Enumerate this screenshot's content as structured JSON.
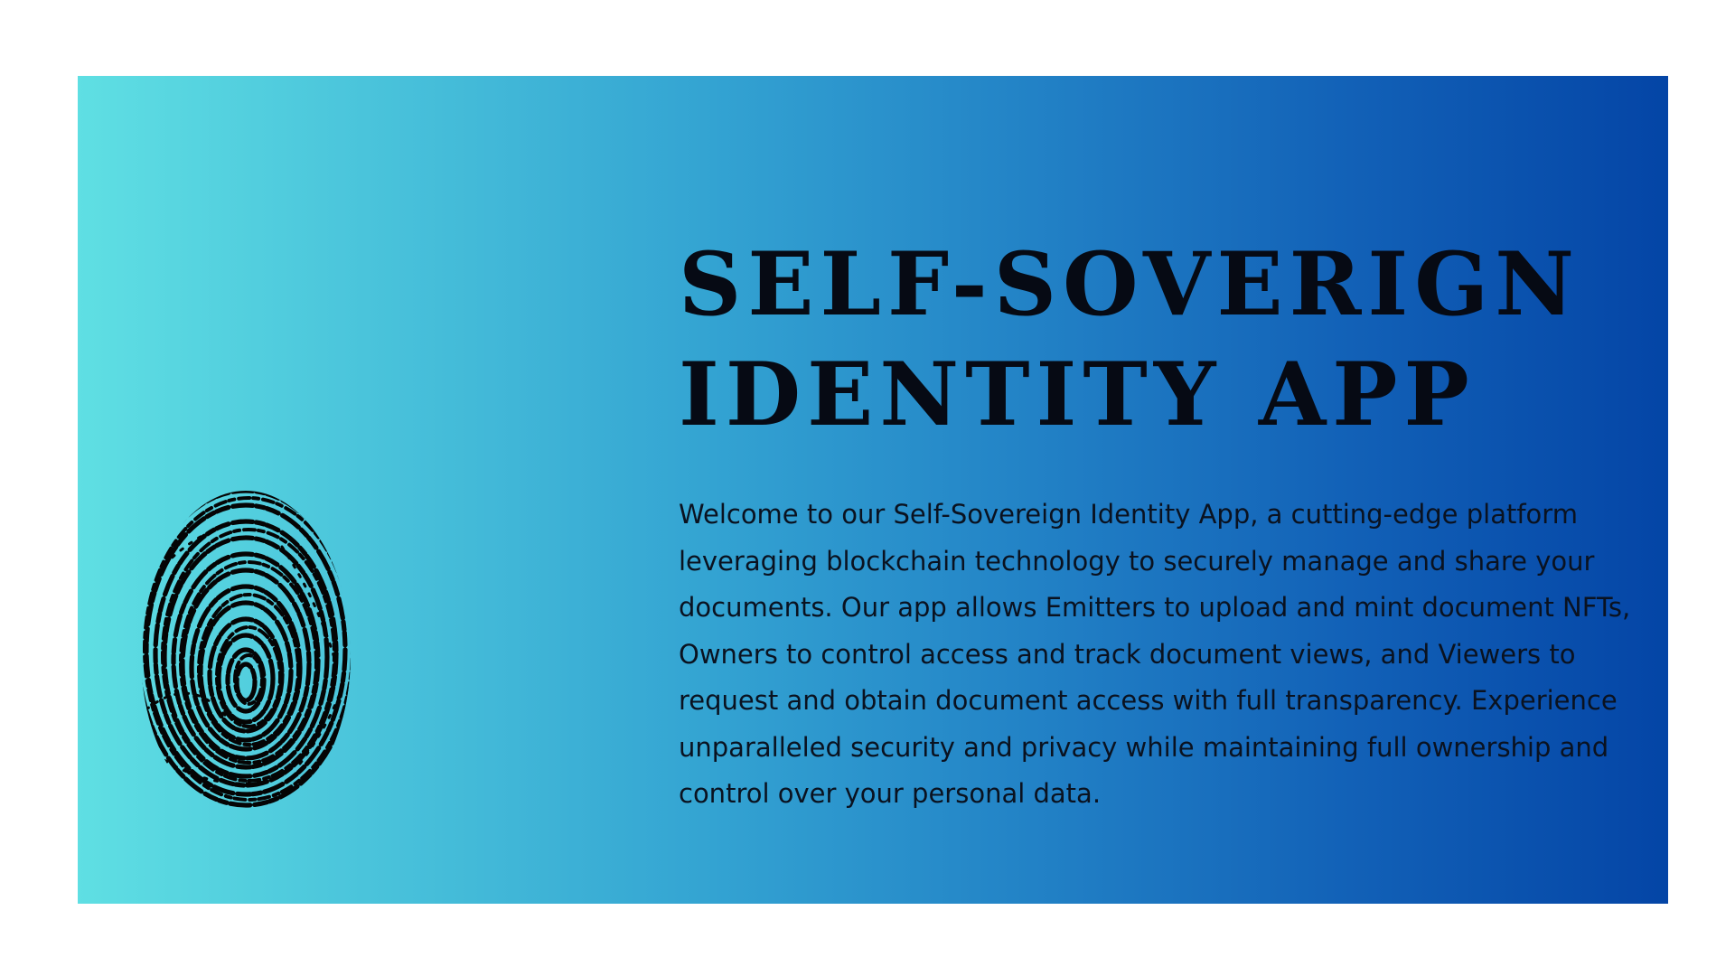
{
  "slide": {
    "title_line1": "SELF-SOVERIGN",
    "title_line2": "IDENTITY APP",
    "description": "Welcome to our Self-Sovereign Identity App, a cutting-edge platform leveraging blockchain technology to securely manage and share your documents. Our app allows Emitters to upload and mint document NFTs, Owners to control access and track document views, and Viewers to request and obtain document access with full transparency. Experience unparalleled security and privacy while maintaining full ownership and control over your personal data.",
    "icon": "fingerprint-icon"
  },
  "colors": {
    "gradient_start": "#5fdfe3",
    "gradient_end": "#0445a6",
    "text": "#060a14",
    "background": "#ffffff"
  }
}
